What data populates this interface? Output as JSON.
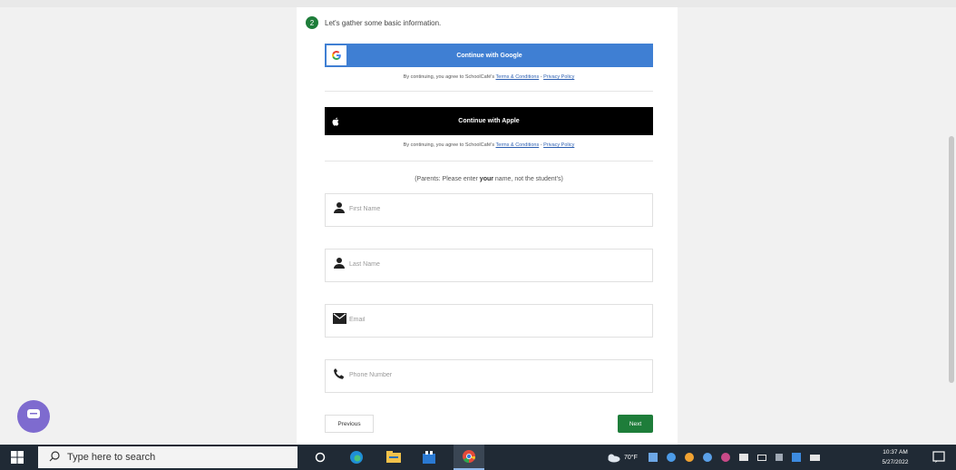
{
  "form": {
    "step_number": "2",
    "step_text": "Let's gather some basic information.",
    "google_label": "Continue with Google",
    "apple_label": "Continue with Apple",
    "terms_prefix": "By continuing, you agree to SchoolCafé's",
    "terms_link": "Terms & Conditions",
    "terms_sep": " - ",
    "privacy_link": "Privacy Policy",
    "parents_pre": "(Parents: Please enter ",
    "parents_bold": "your",
    "parents_post": " name, not the student's)",
    "first_name_placeholder": "First Name",
    "last_name_placeholder": "Last Name",
    "email_placeholder": "Email",
    "phone_placeholder": "Phone Number",
    "previous_label": "Previous",
    "next_label": "Next"
  },
  "taskbar": {
    "search_placeholder": "Type here to search",
    "temperature": "70°F",
    "time": "10:37 AM",
    "date": "5/27/2022"
  },
  "colors": {
    "google_blue": "#3f7fd3",
    "apple_black": "#000000",
    "brand_green": "#1e7d3a",
    "chat_purple": "#7e6bcf",
    "taskbar_bg": "#202a35"
  },
  "icons": [
    "google-icon",
    "apple-icon",
    "person-icon",
    "envelope-icon",
    "phone-icon",
    "chat-icon",
    "windows-icon",
    "search-icon",
    "task-view-icon",
    "edge-icon",
    "file-explorer-icon",
    "store-icon",
    "chrome-icon",
    "weather-icon",
    "notification-icon"
  ]
}
